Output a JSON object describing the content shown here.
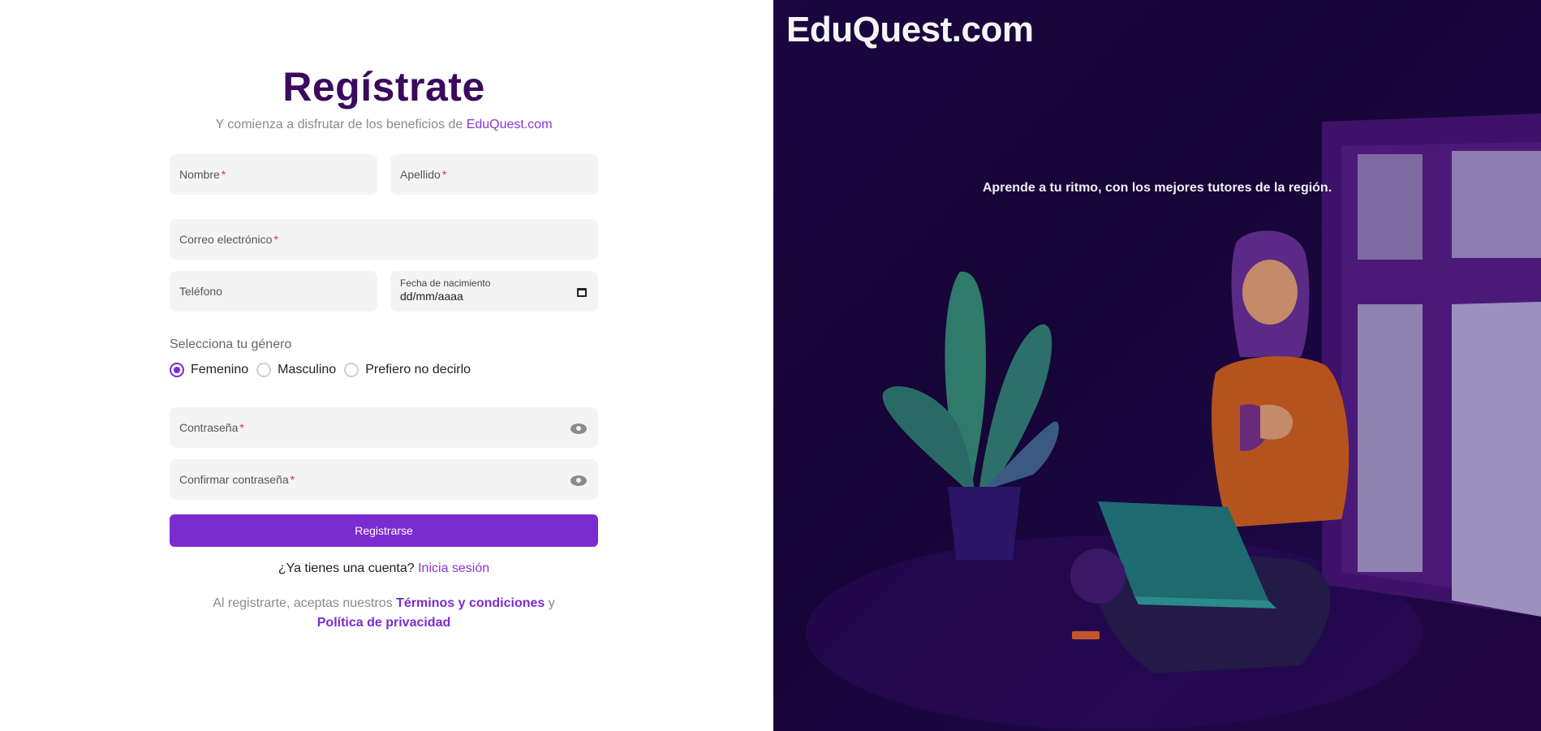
{
  "form": {
    "title": "Regístrate",
    "subtitle_prefix": "Y comienza a disfrutar de los beneficios de",
    "subtitle_brand": "EduQuest.com",
    "fields": {
      "nombre": "Nombre",
      "apellido": "Apellido",
      "email": "Correo electrónico",
      "telefono": "Teléfono",
      "fecha_label": "Fecha de nacimiento",
      "fecha_value": "dd/mm/aaaa",
      "password": "Contraseña",
      "confirm_password": "Confirmar contraseña"
    },
    "required_marker": "*",
    "gender": {
      "question": "Selecciona tu género",
      "options": [
        "Femenino",
        "Masculino",
        "Prefiero no decirlo"
      ],
      "selected": "Femenino"
    },
    "submit_label": "Registrarse",
    "login_prompt": "¿Ya tienes una cuenta?",
    "login_link": "Inicia sesión",
    "terms_prefix": "Al registrarte, aceptas nuestros",
    "terms_link": "Términos y condiciones",
    "terms_join": "y",
    "privacy_link": "Política de privacidad"
  },
  "hero": {
    "brand": "EduQuest.com",
    "tagline": "Aprende a tu ritmo, con los mejores tutores de la región."
  },
  "colors": {
    "primary": "#7b2bd0",
    "title": "#3a0a5e",
    "field_bg": "#f4f4f4",
    "hero_bg": "#1a0640"
  }
}
